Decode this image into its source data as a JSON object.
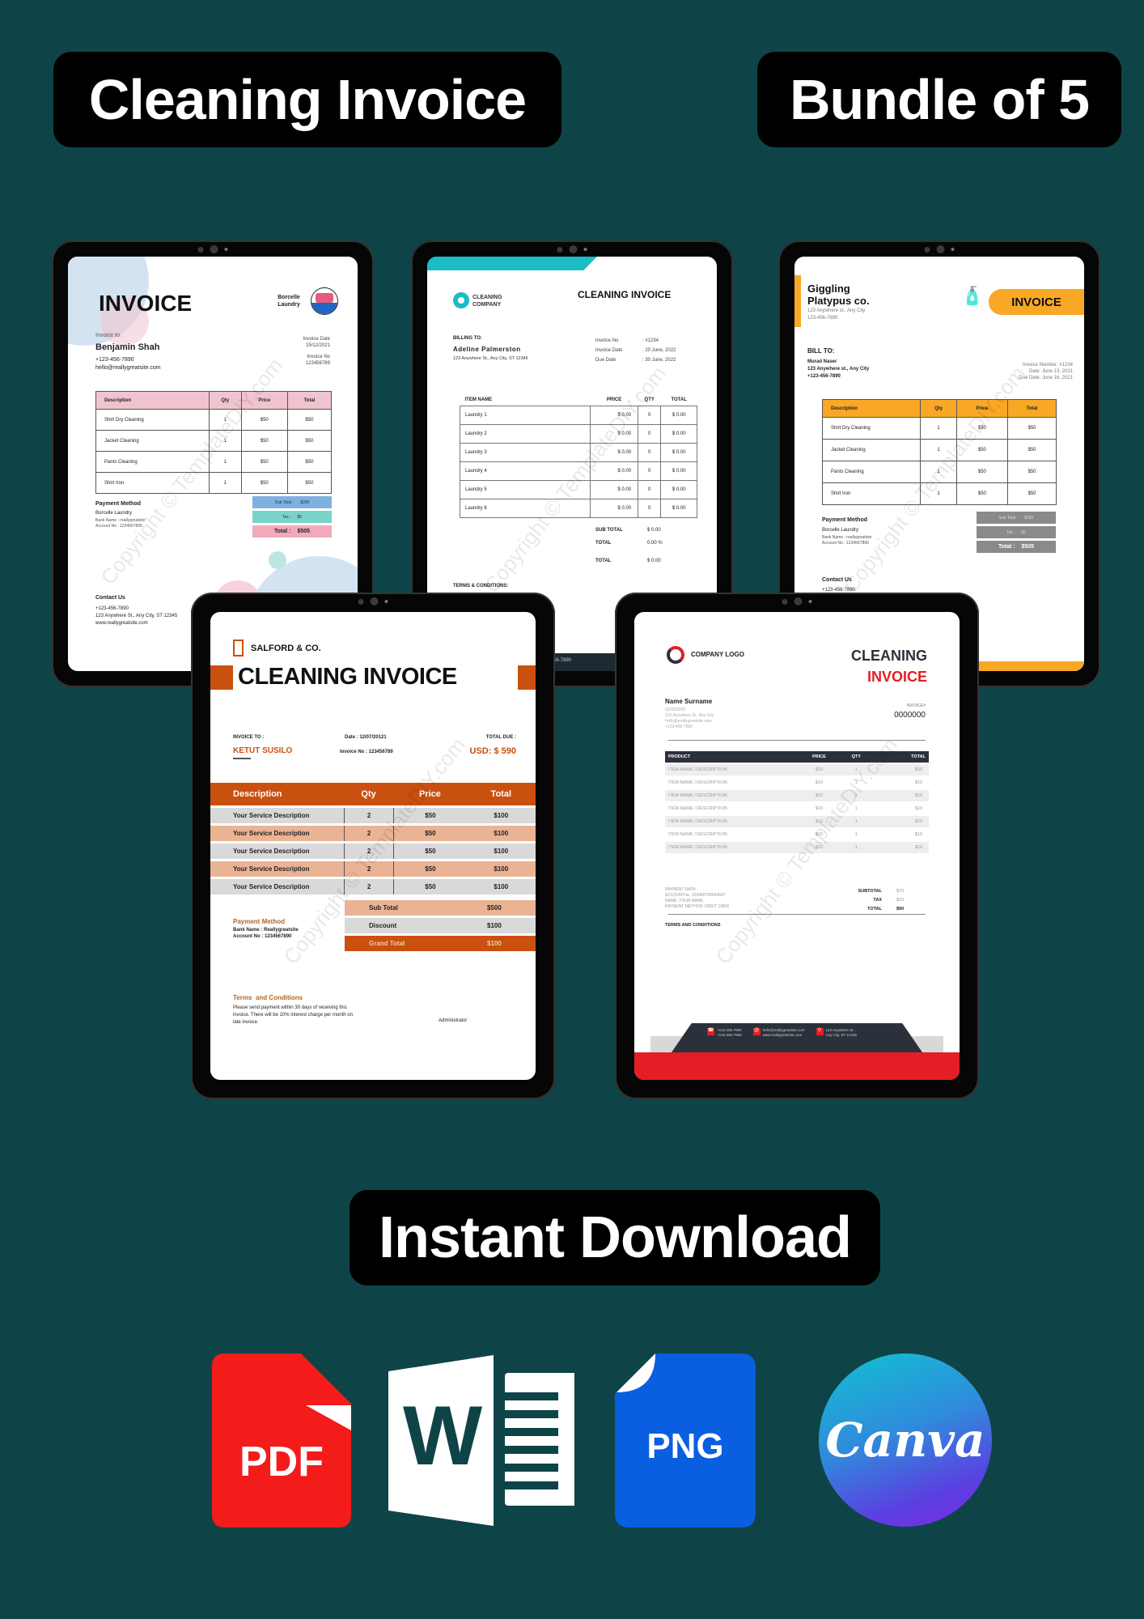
{
  "header": {
    "title": "Cleaning Invoice",
    "bundle": "Bundle of 5"
  },
  "watermark": "Copyright © TemplateDIY.com",
  "templates": [
    {
      "style": "pastel",
      "title": "INVOICE",
      "company": "Borcelle Laundry",
      "invoice_to_label": "Invoice to :",
      "client_name": "Benjamin Shah",
      "client_phone": "+123-456-7890",
      "client_email": "hello@reallygreatsite.com",
      "invoice_date_label": "Invoice Date",
      "invoice_date": "15/12/2021",
      "invoice_no_label": "Invoice No",
      "invoice_no": "123456789",
      "columns": [
        "Description",
        "Qty",
        "Price",
        "Total"
      ],
      "rows": [
        [
          "Shirt Dry Cleaning",
          "1",
          "$50",
          "$50"
        ],
        [
          "Jacket Cleaning",
          "1",
          "$50",
          "$50"
        ],
        [
          "Pants Cleaning",
          "1",
          "$50",
          "$50"
        ],
        [
          "Shirt Iron",
          "1",
          "$50",
          "$50"
        ]
      ],
      "payment_label": "Payment Method",
      "payment_company": "Borcelle Laundry",
      "bank_name": "Bank Name : reallygreatsite",
      "account_no": "Account No : 1234567890",
      "subtotal_label": "Sub Total :",
      "subtotal": "$200",
      "tax_label": "Tax :",
      "tax": "$5",
      "total_label": "Total :",
      "total": "$505",
      "contact_label": "Contact Us",
      "contact_phone": "+123-456-7890",
      "contact_address": "123 Anywhere St., Any City, ST 12345",
      "contact_web": "www.reallygreatsite.com",
      "colors": {
        "header": "#f0c4cf",
        "subtotal": "#7fb1e0",
        "tax": "#7ad3c8",
        "total": "#f2a9bb"
      }
    },
    {
      "style": "teal",
      "company_line1": "CLEANING",
      "company_line2": "COMPANY",
      "title": "CLEANING INVOICE",
      "billing_label": "BILLING TO:",
      "client_name": "Adeline Palmerston",
      "client_address": "123 Anywhere St., Any City, ST 12345",
      "meta": [
        {
          "label": "Invoice No",
          "value": ": #1234"
        },
        {
          "label": "Invoice Date",
          "value": ": 20 June, 2022"
        },
        {
          "label": "Due Date",
          "value": ": 30 June, 2022"
        }
      ],
      "columns": [
        "ITEM NAME",
        "PRICE",
        "QTY",
        "TOTAL"
      ],
      "rows": [
        [
          "Laundry 1",
          "$ 0.00",
          "0",
          "$ 0.00"
        ],
        [
          "Laundry 2",
          "$ 0.00",
          "0",
          "$ 0.00"
        ],
        [
          "Laundry 3",
          "$ 0.00",
          "0",
          "$ 0.00"
        ],
        [
          "Laundry 4",
          "$ 0.00",
          "0",
          "$ 0.00"
        ],
        [
          "Laundry 5",
          "$ 0.00",
          "0",
          "$ 0.00"
        ],
        [
          "Laundry 6",
          "$ 0.00",
          "0",
          "$ 0.00"
        ]
      ],
      "totals": [
        {
          "label": "SUB TOTAL",
          "value": "$ 0.00"
        },
        {
          "label": "TOTAL",
          "value": "0.00 %"
        },
        {
          "label": "TOTAL",
          "value": "$ 0.00"
        }
      ],
      "terms_label": "TERMS & CONDITIONS:",
      "footer_phone": "56-7890",
      "colors": {
        "accent": "#1bbcc4"
      }
    },
    {
      "style": "orange",
      "company_line1": "Giggling",
      "company_line2": "Platypus co.",
      "company_address": "123 Anywhere st., Any City",
      "company_phone": "123-456-7890",
      "title": "INVOICE",
      "bill_to_label": "BILL TO:",
      "client_name": "Murad Naser",
      "client_address": "123 Anywhere st., Any City",
      "client_phone": "+123-456-7890",
      "invoice_number": "Invoice Number: #1234",
      "date": "Date: June 13, 2021",
      "due_date": "Due Date: June 16, 2021",
      "columns": [
        "Description",
        "Qty",
        "Price",
        "Total"
      ],
      "rows": [
        [
          "Shirt Dry Cleaning",
          "1",
          "$50",
          "$50"
        ],
        [
          "Jacket Cleaning",
          "1",
          "$50",
          "$50"
        ],
        [
          "Pants Cleaning",
          "1",
          "$50",
          "$50"
        ],
        [
          "Shirt Iron",
          "1",
          "$50",
          "$50"
        ]
      ],
      "payment_label": "Payment Method",
      "payment_company": "Borcelle Laundry",
      "bank_name": "Bank Name : reallygreatsite",
      "account_no": "Account No : 1234567890",
      "subtotal_label": "Sub Total :",
      "subtotal": "$200",
      "tax_label": "Tax :",
      "tax": "$5",
      "total_label": "Total :",
      "total": "$505",
      "contact_label": "Contact Us",
      "contact_phone": "+123-456-7890",
      "colors": {
        "accent": "#f9a825",
        "summary": "#8a8a8a"
      }
    },
    {
      "style": "rust",
      "company": "SALFORD & CO.",
      "title": "CLEANING INVOICE",
      "invoice_to_label": "INVOICE TO :",
      "client_name": "KETUT SUSILO",
      "date": "Date : 12/07/20121",
      "invoice_no": "Invoice No : 123456789",
      "total_due_label": "TOTAL DUE :",
      "total_due": "USD: $ 590",
      "columns": [
        "Description",
        "Qty",
        "Price",
        "Total"
      ],
      "rows": [
        [
          "Your Service Description",
          "2",
          "$50",
          "$100"
        ],
        [
          "Your Service Description",
          "2",
          "$50",
          "$100"
        ],
        [
          "Your Service Description",
          "2",
          "$50",
          "$100"
        ],
        [
          "Your Service Description",
          "2",
          "$50",
          "$100"
        ],
        [
          "Your Service Description",
          "2",
          "$50",
          "$100"
        ]
      ],
      "payment_label": "Payment Method",
      "bank_name": "Bank Name : Reallygreatsite",
      "account_no": "Account No : 1234567890",
      "subtotal_label": "Sub Total",
      "subtotal": "$500",
      "discount_label": "Discount",
      "discount": "$100",
      "grand_total_label": "Grand Total",
      "grand_total": "$100",
      "terms_label": "Terms  and Conditions",
      "terms_text": "Please send payment within 30 days of receiving this invoice. There will be 10% interest charge per month on late invoice.",
      "signature": "Administrator",
      "colors": {
        "accent": "#c9500f",
        "light": "#eab394",
        "gray": "#d9d9d9",
        "label": "#b7661f"
      }
    },
    {
      "style": "red-dark",
      "company": "COMPANY LOGO",
      "title_line1": "CLEANING",
      "title_line2": "INVOICE",
      "client_name": "Name Surname",
      "client_date": "02/05/2025",
      "client_address": "123 Anywhere St., Any City",
      "client_email": "hello@reallygreatsite.com",
      "client_phone": "+123-456-7890",
      "invoice_label": "INVOICE#",
      "invoice_no": "0000000",
      "columns": [
        "PRODUCT",
        "PRICE",
        "QTY",
        "TOTAL"
      ],
      "rows": [
        [
          "ITEM NAME / DESCRIPTION",
          "$10",
          "1",
          "$10"
        ],
        [
          "ITEM NAME / DESCRIPTION",
          "$10",
          "1",
          "$10"
        ],
        [
          "ITEM NAME / DESCRIPTION",
          "$10",
          "1",
          "$10"
        ],
        [
          "ITEM NAME / DESCRIPTION",
          "$10",
          "1",
          "$10"
        ],
        [
          "ITEM NAME / DESCRIPTION",
          "$10",
          "1",
          "$10"
        ],
        [
          "ITEM NAME / DESCRIPTION",
          "$10",
          "1",
          "$10"
        ],
        [
          "ITEM NAME / DESCRIPTION",
          "$10",
          "1",
          "$10"
        ]
      ],
      "payment_lines": [
        "PAYMENT DATA:",
        "ACCOUNT№: 123456789654597",
        "NAME: YOUR NAME",
        "PAYMENT METHOD: DEBIT CARD"
      ],
      "totals": [
        {
          "label": "SUBTOTAL",
          "value": "$70"
        },
        {
          "label": "TAX",
          "value": "$20"
        },
        {
          "label": "TOTAL",
          "value": "$90"
        }
      ],
      "terms_label": "TERMS AND CONDITIONS",
      "footer": {
        "phone": "+123-456-7890\n+123-456-7890",
        "email": "hello@reallygreatsite.com\nwww.reallygreatsite.com",
        "address": "123 Anywhere St.,\nAny City, ST 12345"
      },
      "colors": {
        "dark": "#2b313b",
        "red": "#e31e24"
      }
    }
  ],
  "cta": {
    "label": "Instant Download"
  },
  "formats": [
    {
      "name": "PDF",
      "icon": "pdf-file-icon",
      "color": "#f41b1b"
    },
    {
      "name": "W",
      "icon": "word-icon",
      "color": "#ffffff"
    },
    {
      "name": "PNG",
      "icon": "png-file-icon",
      "color": "#0a5ee0"
    },
    {
      "name": "Canva",
      "icon": "canva-logo",
      "color": "#7d2ae8"
    }
  ]
}
